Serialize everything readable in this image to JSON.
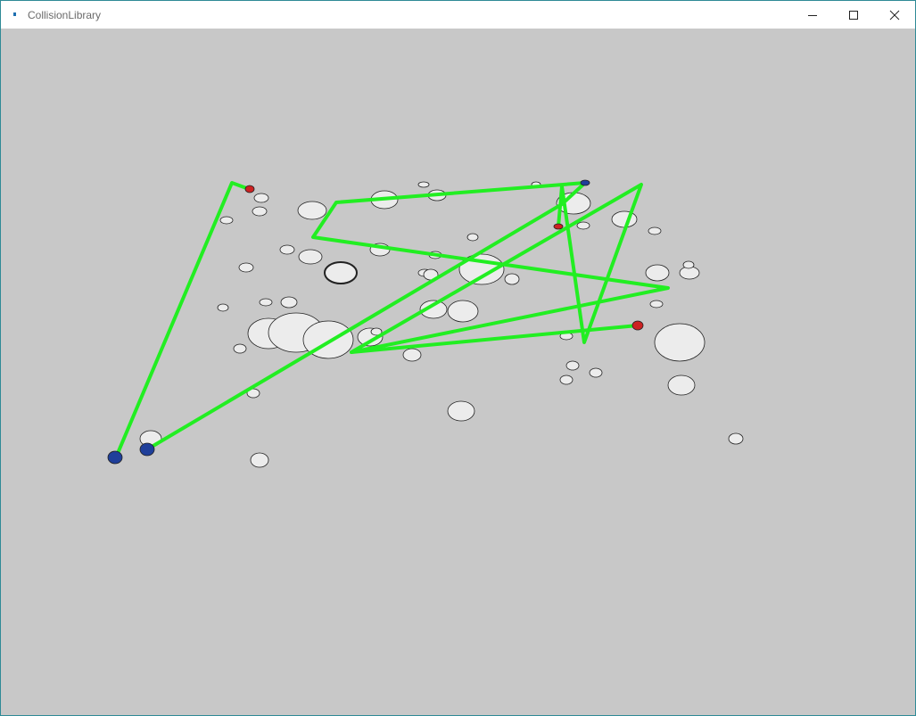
{
  "window": {
    "title": "CollisionLibrary",
    "icon": "app-icon",
    "controls": {
      "minimize_icon": "minimize-icon",
      "maximize_icon": "maximize-icon",
      "close_icon": "close-icon"
    }
  },
  "scene": {
    "background_color": "#c8c8c8",
    "path_color": "#22ee22",
    "sphere_fill": "#ececec",
    "sphere_outline": "#222222",
    "endpoint_red": "#cc2222",
    "endpoint_blue": "#1f3f9a"
  }
}
